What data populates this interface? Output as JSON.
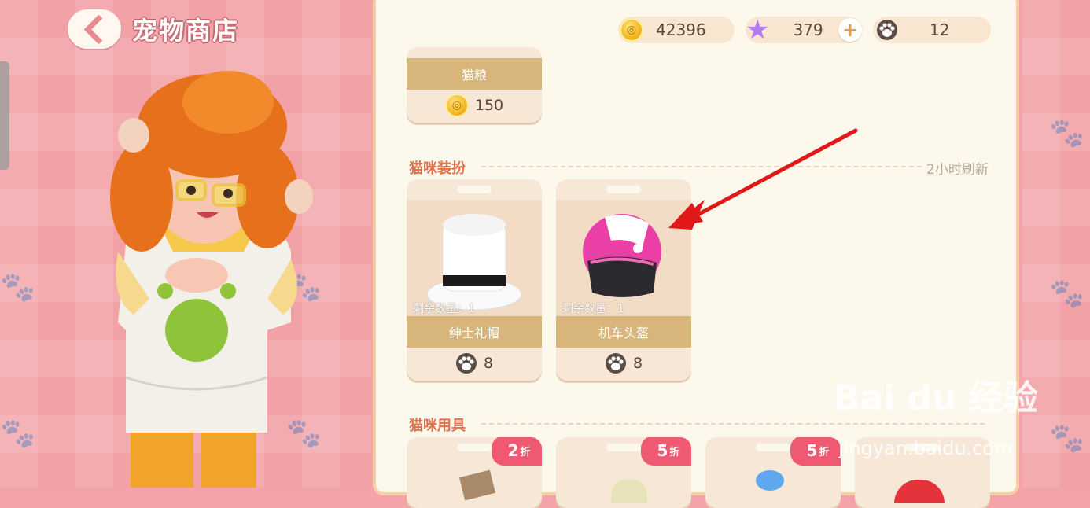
{
  "header": {
    "title": "宠物商店"
  },
  "resources": {
    "coins": "42396",
    "stars": "379",
    "paws": "12"
  },
  "top_item": {
    "name": "猫粮",
    "price": "150"
  },
  "sections": {
    "cat_dressup": {
      "title": "猫咪装扮",
      "refresh_text": "2小时刷新"
    },
    "cat_supplies": {
      "title": "猫咪用具"
    }
  },
  "dressup_items": [
    {
      "name": "绅士礼帽",
      "remain": "剩余数量：1",
      "price": "8"
    },
    {
      "name": "机车头盔",
      "remain": "剩余数量：1",
      "price": "8"
    }
  ],
  "supply_items": [
    {
      "discount": "2",
      "discount_unit": "折"
    },
    {
      "discount": "5",
      "discount_unit": "折"
    },
    {
      "discount": "5",
      "discount_unit": "折"
    }
  ],
  "watermark": {
    "brand": "Bai du 经验",
    "url": "jingyan.baidu.com"
  },
  "colors": {
    "accent": "#e0704a",
    "panel": "#fdf8ec",
    "background": "#f2a1a6",
    "arrow": "#e01818"
  }
}
